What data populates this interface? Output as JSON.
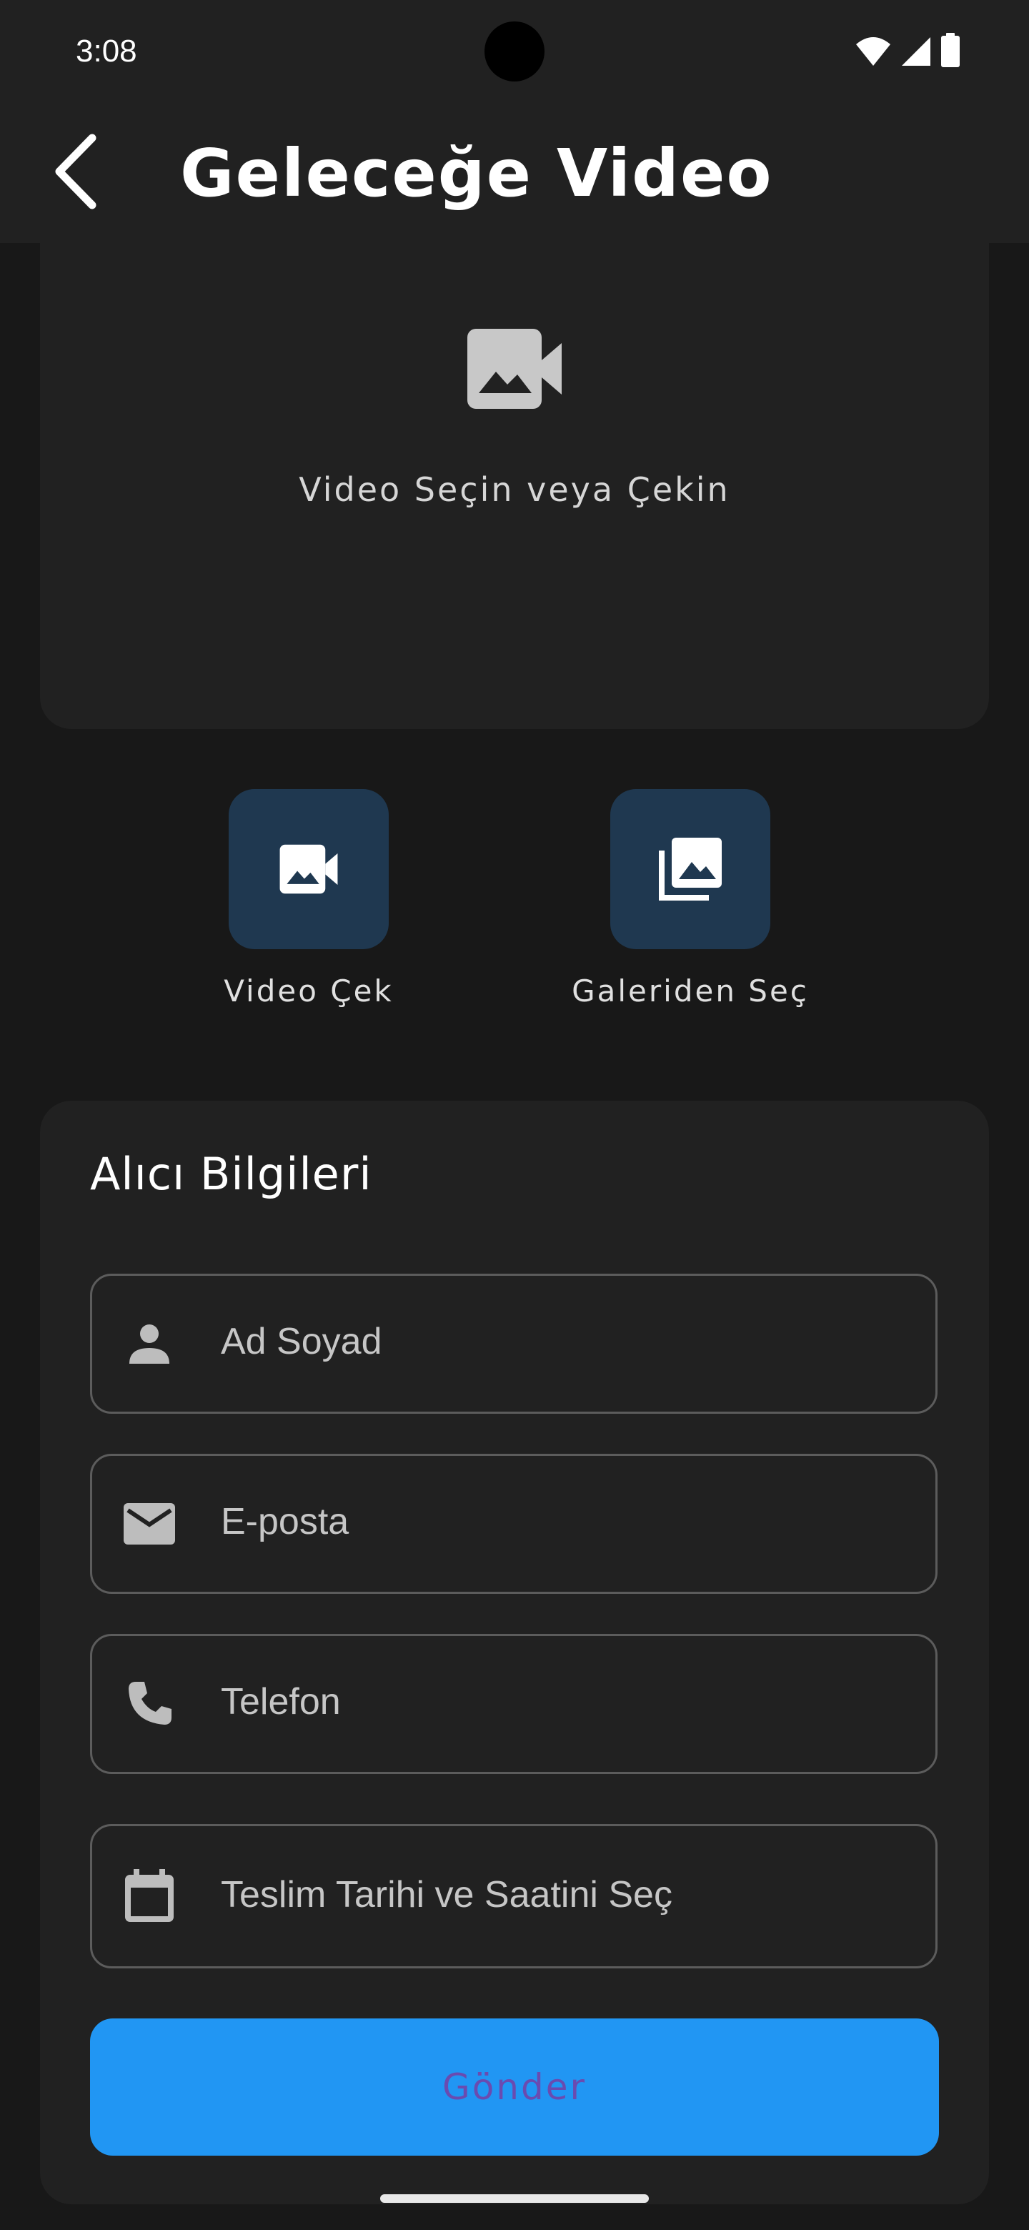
{
  "status_bar": {
    "time": "3:08",
    "icons": [
      "wifi-icon",
      "cellular-signal-icon",
      "battery-icon"
    ]
  },
  "app_bar": {
    "back_icon": "arrow-back-icon",
    "title": "Geleceğe Video"
  },
  "video_picker": {
    "icon": "video-camera-icon",
    "prompt": "Video Seçin veya Çekin"
  },
  "actions": [
    {
      "label": "Video Çek",
      "icon": "video-camera-icon"
    },
    {
      "label": "Galeriden Seç",
      "icon": "photo-library-icon"
    }
  ],
  "recipient_form": {
    "title": "Alıcı Bilgileri",
    "fields": {
      "name": {
        "placeholder": "Ad Soyad",
        "icon": "person-icon"
      },
      "email": {
        "placeholder": "E-posta",
        "icon": "email-icon"
      },
      "phone": {
        "placeholder": "Telefon",
        "icon": "phone-icon"
      },
      "delivery": {
        "label": "Teslim Tarihi ve Saatini Seç",
        "icon": "calendar-icon"
      }
    },
    "submit_label": "Gönder"
  },
  "colors": {
    "background": "#181818",
    "card": "#212121",
    "action_tile": "#1f3850",
    "submit_button": "#2196f3",
    "submit_text": "#6a4bb0",
    "field_border": "#5c5c5c"
  }
}
